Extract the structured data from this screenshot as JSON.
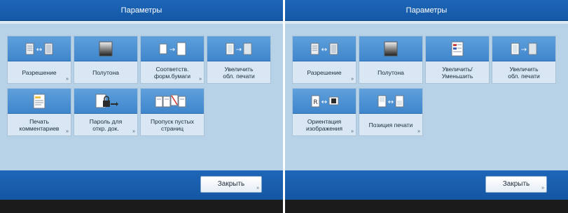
{
  "left": {
    "title": "Параметры",
    "tiles": [
      {
        "label": "Разрешение",
        "icon": "resolution-icon"
      },
      {
        "label": "Полутона",
        "icon": "halftone-icon"
      },
      {
        "label": "Соответств.\nформ.бумаги",
        "icon": "match-paper-size-icon"
      },
      {
        "label": "Увеличить\nобл. печати",
        "icon": "enlarge-print-area-icon"
      },
      {
        "label": "Печать\nкомментариев",
        "icon": "print-comments-icon"
      },
      {
        "label": "Пароль для\nоткр. док.",
        "icon": "document-password-icon"
      },
      {
        "label": "Пропуск пустых\nстраниц",
        "icon": "skip-blank-pages-icon"
      }
    ],
    "close_label": "Закрыть"
  },
  "right": {
    "title": "Параметры",
    "tiles": [
      {
        "label": "Разрешение",
        "icon": "resolution-icon"
      },
      {
        "label": "Полутона",
        "icon": "halftone-icon"
      },
      {
        "label": "Увеличить/\nУменьшить",
        "icon": "enlarge-reduce-icon"
      },
      {
        "label": "Увеличить\nобл. печати",
        "icon": "enlarge-print-area-icon"
      },
      {
        "label": "Ориентация\nизображения",
        "icon": "image-orientation-icon"
      },
      {
        "label": "Позиция печати",
        "icon": "print-position-icon"
      }
    ],
    "close_label": "Закрыть"
  },
  "more_indicator": "»",
  "colors": {
    "header": "#1458a6",
    "body": "#b7d1e7",
    "tile_icon_zone": "#4a90d4",
    "bottom_bar": "#1b1b1b"
  }
}
